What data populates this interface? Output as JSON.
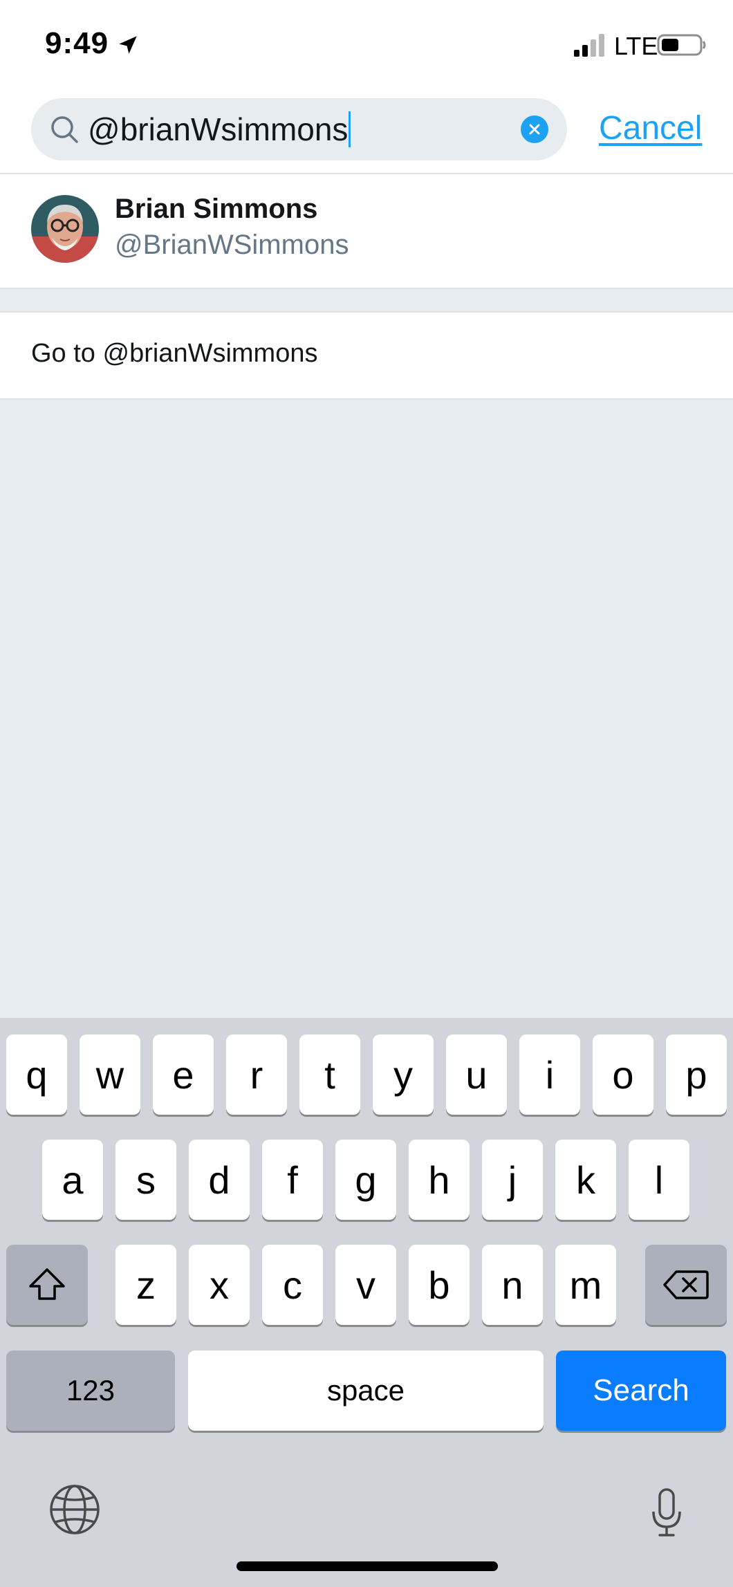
{
  "status_bar": {
    "time": "9:49",
    "network": "LTE",
    "location_icon": "location-arrow-icon",
    "signal_icon": "cellular-signal-icon",
    "battery_icon": "battery-icon"
  },
  "search": {
    "query": "@brianWsimmons",
    "icon": "search-icon",
    "clear_icon": "clear-icon",
    "cancel_label": "Cancel"
  },
  "results": [
    {
      "name": "Brian Simmons",
      "handle": "@BrianWSimmons"
    }
  ],
  "goto": {
    "label": "Go to @brianWsimmons"
  },
  "keyboard": {
    "row1": [
      "q",
      "w",
      "e",
      "r",
      "t",
      "y",
      "u",
      "i",
      "o",
      "p"
    ],
    "row2": [
      "a",
      "s",
      "d",
      "f",
      "g",
      "h",
      "j",
      "k",
      "l"
    ],
    "row3": [
      "z",
      "x",
      "c",
      "v",
      "b",
      "n",
      "m"
    ],
    "numbers_label": "123",
    "space_label": "space",
    "search_label": "Search",
    "shift_icon": "shift-icon",
    "delete_icon": "delete-icon",
    "globe_icon": "globe-icon",
    "microphone_icon": "microphone-icon"
  },
  "colors": {
    "accent": "#1da1f2",
    "search_key": "#0a7cff",
    "background": "#e6ecf0",
    "keyboard_bg": "#d1d5db",
    "special_key": "#abb0ba"
  }
}
